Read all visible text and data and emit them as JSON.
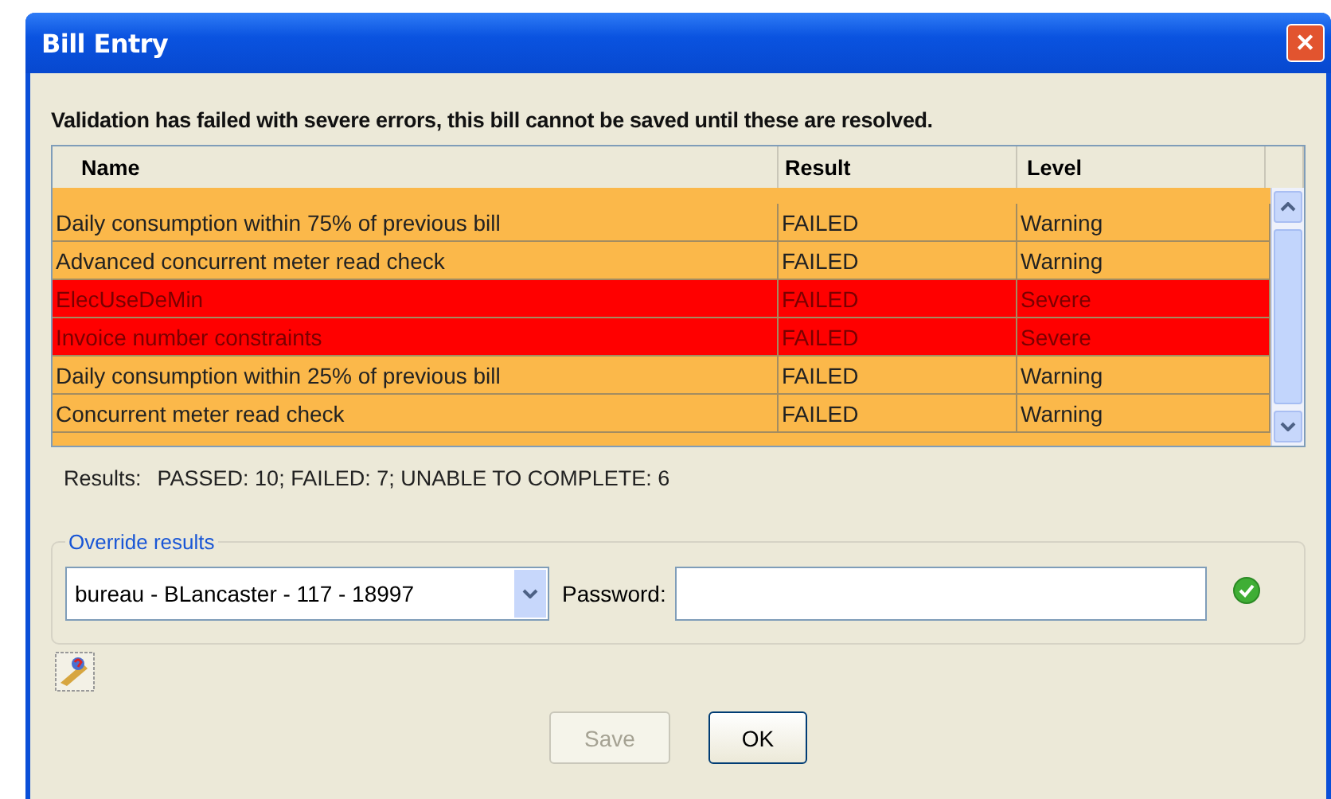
{
  "window": {
    "title": "Bill Entry",
    "close": "✕"
  },
  "message": "Validation has failed with severe errors, this bill cannot be saved until these are resolved.",
  "table": {
    "columns": [
      "Name",
      "Result",
      "Level"
    ],
    "rows": [
      {
        "name": "Daily consumption within 75% of previous bill",
        "result": "FAILED",
        "level": "Warning",
        "color": "#fbb84a"
      },
      {
        "name": "Advanced concurrent meter read check",
        "result": "FAILED",
        "level": "Warning",
        "color": "#fbb84a"
      },
      {
        "name": "ElecUseDeMin",
        "result": "FAILED",
        "level": "Severe",
        "color": "#ff0000"
      },
      {
        "name": "Invoice number constraints",
        "result": "FAILED",
        "level": "Severe",
        "color": "#ff0000"
      },
      {
        "name": "Daily consumption within 25% of previous bill",
        "result": "FAILED",
        "level": "Warning",
        "color": "#fbb84a"
      },
      {
        "name": "Concurrent meter read check",
        "result": "FAILED",
        "level": "Warning",
        "color": "#fbb84a"
      }
    ]
  },
  "results": {
    "label": "Results:",
    "value": "PASSED: 10; FAILED: 7; UNABLE TO COMPLETE: 6"
  },
  "override": {
    "legend": "Override results",
    "user": "bureau - BLancaster - 117 - 18997",
    "password_label": "Password:",
    "valid": true
  },
  "buttons": [
    {
      "label": "Save",
      "disabled": true
    },
    {
      "label": "OK",
      "disabled": false
    }
  ]
}
